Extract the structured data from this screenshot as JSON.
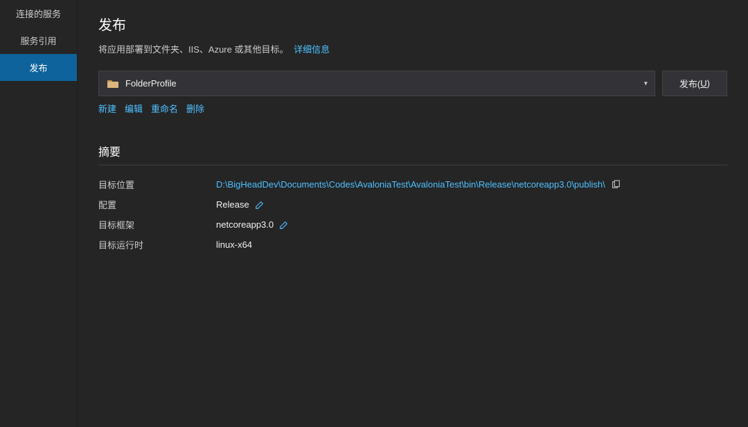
{
  "sidebar": {
    "items": [
      {
        "label": "连接的服务"
      },
      {
        "label": "服务引用"
      },
      {
        "label": "发布"
      }
    ],
    "activeIndex": 2
  },
  "header": {
    "title": "发布",
    "subtitle": "将应用部署到文件夹、IIS、Azure 或其他目标。",
    "moreInfo": "详细信息"
  },
  "profile": {
    "selected": "FolderProfile",
    "publishButton": "发布(",
    "publishButtonUnderline": "U",
    "publishButtonEnd": ")"
  },
  "actions": {
    "new": "新建",
    "edit": "编辑",
    "rename": "重命名",
    "delete": "删除"
  },
  "summary": {
    "title": "摘要",
    "rows": {
      "targetLocation": {
        "label": "目标位置",
        "value": "D:\\BigHeadDev\\Documents\\Codes\\AvaloniaTest\\AvaloniaTest\\bin\\Release\\netcoreapp3.0\\publish\\"
      },
      "configuration": {
        "label": "配置",
        "value": "Release"
      },
      "targetFramework": {
        "label": "目标框架",
        "value": "netcoreapp3.0"
      },
      "targetRuntime": {
        "label": "目标运行时",
        "value": "linux-x64"
      }
    }
  }
}
